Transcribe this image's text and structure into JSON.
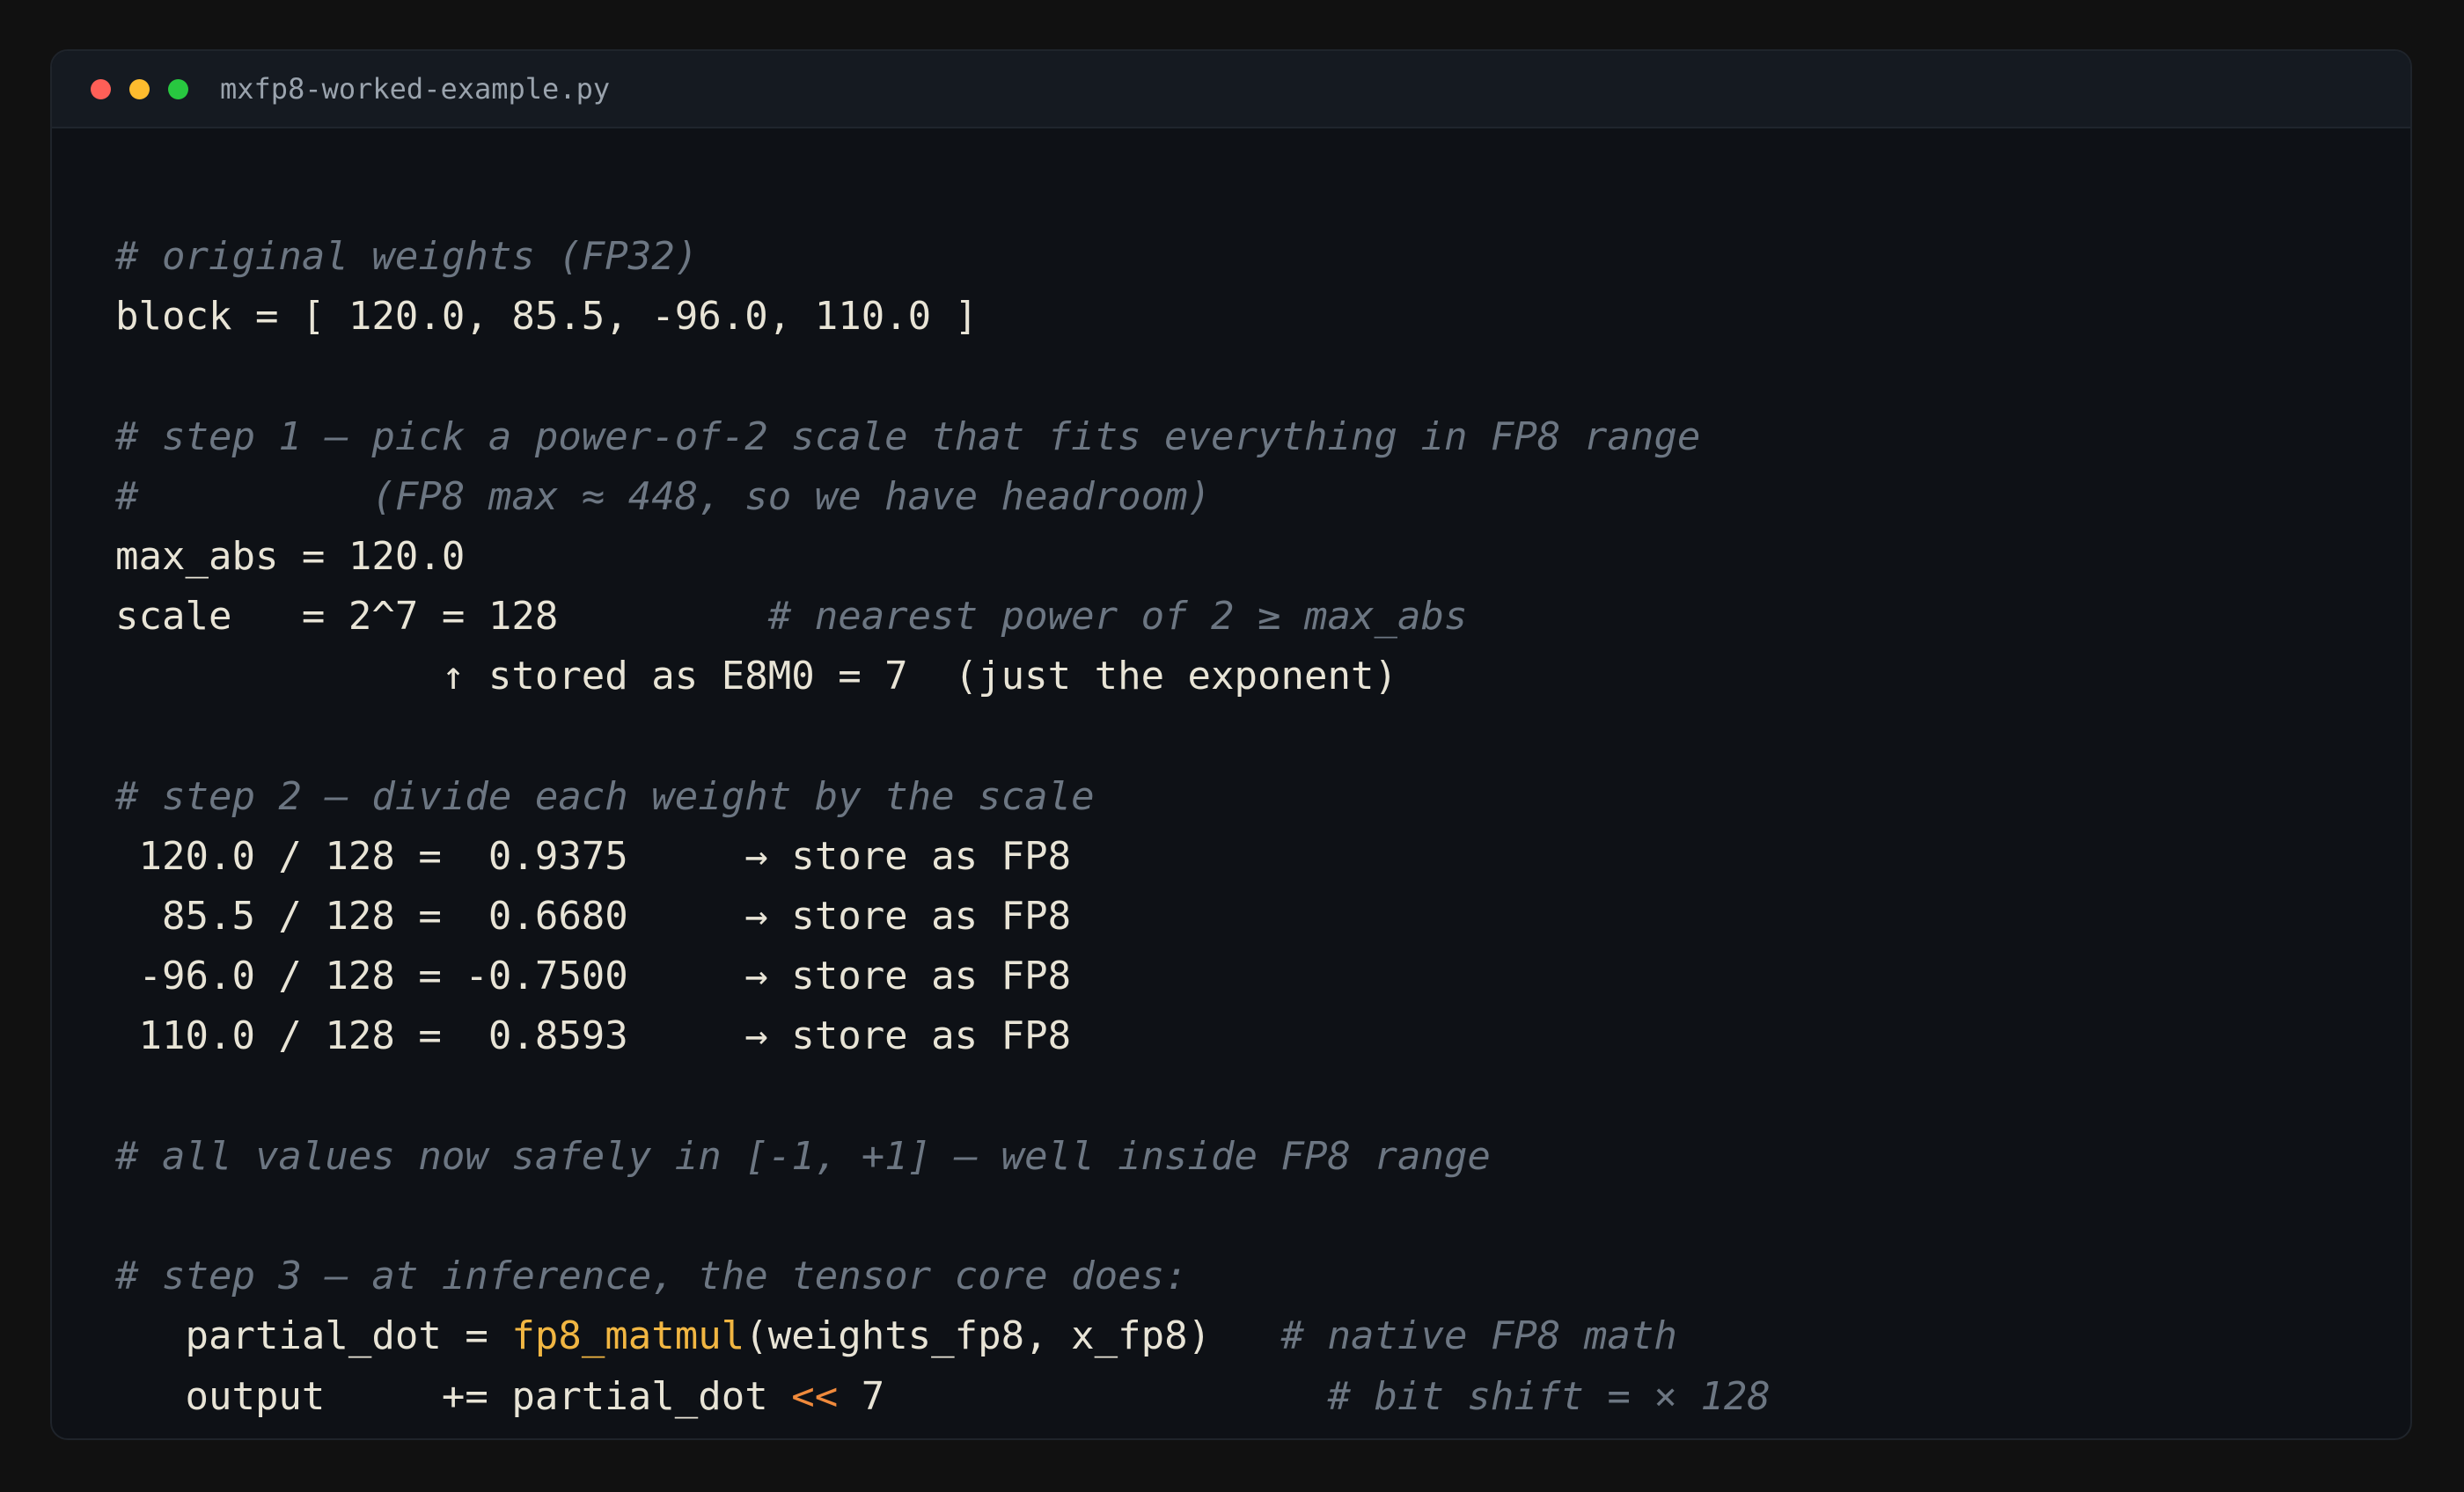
{
  "window": {
    "file_name": "mxfp8-worked-example.py"
  },
  "code": {
    "lines": [
      [
        {
          "t": "# original weights (FP32)",
          "k": "c"
        }
      ],
      [
        {
          "t": "block = [ 120.0, 85.5, -96.0, 110.0 ]"
        }
      ],
      [],
      [
        {
          "t": "# step 1 — pick a power-of-2 scale that fits everything in FP8 range",
          "k": "c"
        }
      ],
      [
        {
          "t": "#          (FP8 max ≈ 448, so we have headroom)",
          "k": "c"
        }
      ],
      [
        {
          "t": "max_abs = 120.0"
        }
      ],
      [
        {
          "t": "scale   = 2^7 = 128         "
        },
        {
          "t": "# nearest power of 2 ≥ max_abs",
          "k": "c"
        }
      ],
      [
        {
          "t": "              ↑ stored as E8M0 = 7  (just the exponent)"
        }
      ],
      [],
      [
        {
          "t": "# step 2 — divide each weight by the scale",
          "k": "c"
        }
      ],
      [
        {
          "t": " 120.0 / 128 =  0.9375     → store as FP8"
        }
      ],
      [
        {
          "t": "  85.5 / 128 =  0.6680     → store as FP8"
        }
      ],
      [
        {
          "t": " -96.0 / 128 = -0.7500     → store as FP8"
        }
      ],
      [
        {
          "t": " 110.0 / 128 =  0.8593     → store as FP8"
        }
      ],
      [],
      [
        {
          "t": "# all values now safely in [-1, +1] — well inside FP8 range",
          "k": "c"
        }
      ],
      [],
      [
        {
          "t": "# step 3 — at inference, the tensor core does:",
          "k": "c"
        }
      ],
      [
        {
          "t": "   partial_dot = "
        },
        {
          "t": "fp8_matmul",
          "k": "fn"
        },
        {
          "t": "(weights_fp8, x_fp8)   "
        },
        {
          "t": "# native FP8 math",
          "k": "c"
        }
      ],
      [
        {
          "t": "   output     += partial_dot "
        },
        {
          "t": "<<",
          "k": "op"
        },
        {
          "t": " 7                   "
        },
        {
          "t": "# bit shift = × 128",
          "k": "c"
        }
      ]
    ]
  }
}
